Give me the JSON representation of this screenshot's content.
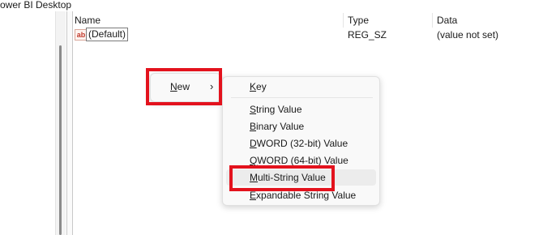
{
  "window": {
    "path_title": "ower BI Desktop"
  },
  "columns": {
    "name": "Name",
    "type": "Type",
    "data": "Data"
  },
  "value_rows": [
    {
      "icon": "ab",
      "name": "(Default)",
      "type": "REG_SZ",
      "data": "(value not set)"
    }
  ],
  "context_menu": {
    "new_item": {
      "accel": "N",
      "rest": "ew",
      "arrow": "›"
    }
  },
  "submenu": {
    "items": [
      {
        "accel": "K",
        "rest": "ey"
      },
      {
        "accel": "S",
        "rest": "tring Value"
      },
      {
        "accel": "B",
        "rest": "inary Value"
      },
      {
        "accel": "D",
        "rest": "WORD (32-bit) Value"
      },
      {
        "accel": "Q",
        "rest": "WORD (64-bit) Value"
      },
      {
        "accel": "M",
        "rest": "ulti-String Value"
      },
      {
        "accel": "E",
        "rest": "xpandable String Value"
      }
    ],
    "hovered_index": 5
  },
  "colors": {
    "annotation_red": "#e3121d",
    "menu_bg": "#f9f9f9",
    "hover_bg": "#ececec"
  }
}
